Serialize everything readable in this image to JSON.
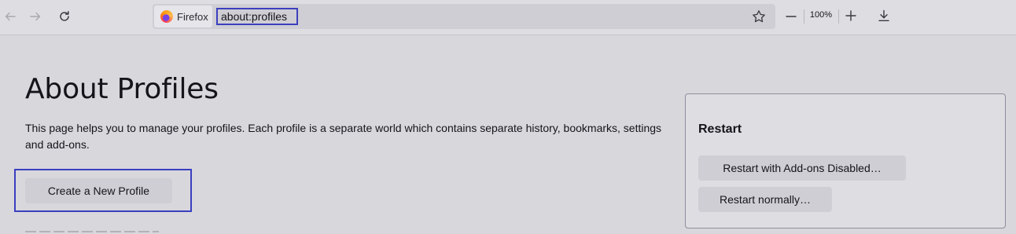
{
  "toolbar": {
    "identity_label": "Firefox",
    "url": "about:profiles",
    "zoom_level": "100%",
    "icons": {
      "back": "back-arrow-icon",
      "forward": "forward-arrow-icon",
      "reload": "reload-icon",
      "bookmark": "star-icon",
      "zoom_out": "minus-icon",
      "zoom_in": "plus-icon",
      "downloads": "download-icon"
    }
  },
  "main": {
    "title": "About Profiles",
    "description": "This page helps you to manage your profiles. Each profile is a separate world which contains separate history, bookmarks, settings and add-ons.",
    "create_button": "Create a New Profile"
  },
  "restart_panel": {
    "heading": "Restart",
    "addons_disabled_button": "Restart with Add-ons Disabled…",
    "normal_button": "Restart normally…"
  },
  "colors": {
    "page_bg": "#d8d7dc",
    "highlight_outline": "#3b3fbf",
    "button_bg": "#cfced4"
  }
}
